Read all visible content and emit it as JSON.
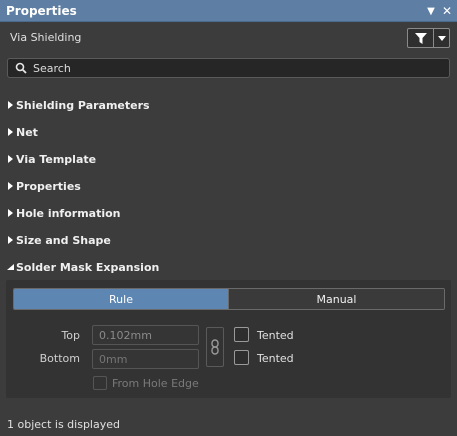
{
  "panel": {
    "title": "Properties"
  },
  "object_type": "Via Shielding",
  "search": {
    "placeholder": "Search",
    "value": ""
  },
  "sections": [
    {
      "label": "Shielding Parameters",
      "expanded": false
    },
    {
      "label": "Net",
      "expanded": false
    },
    {
      "label": "Via Template",
      "expanded": false
    },
    {
      "label": "Properties",
      "expanded": false
    },
    {
      "label": "Hole information",
      "expanded": false
    },
    {
      "label": "Size and Shape",
      "expanded": false
    },
    {
      "label": "Solder Mask Expansion",
      "expanded": true
    }
  ],
  "solder_mask": {
    "modes": [
      "Rule",
      "Manual"
    ],
    "selected_mode": "Rule",
    "top_label": "Top",
    "top_value": "0.102mm",
    "bottom_label": "Bottom",
    "bottom_placeholder": "0mm",
    "tented_top_label": "Tented",
    "tented_top_checked": false,
    "tented_bottom_label": "Tented",
    "tented_bottom_checked": false,
    "from_hole_edge_label": "From Hole Edge",
    "from_hole_edge_checked": false
  },
  "status": "1 object is displayed",
  "colors": {
    "titlebar": "#5e7fa3",
    "accent": "#5e86b3",
    "background": "#3c3c3c"
  },
  "icons": [
    "pin-icon",
    "close-icon",
    "filter-icon",
    "dropdown-arrow-icon",
    "search-icon",
    "expand-arrow-icon",
    "collapse-arrow-icon",
    "link-icon"
  ]
}
